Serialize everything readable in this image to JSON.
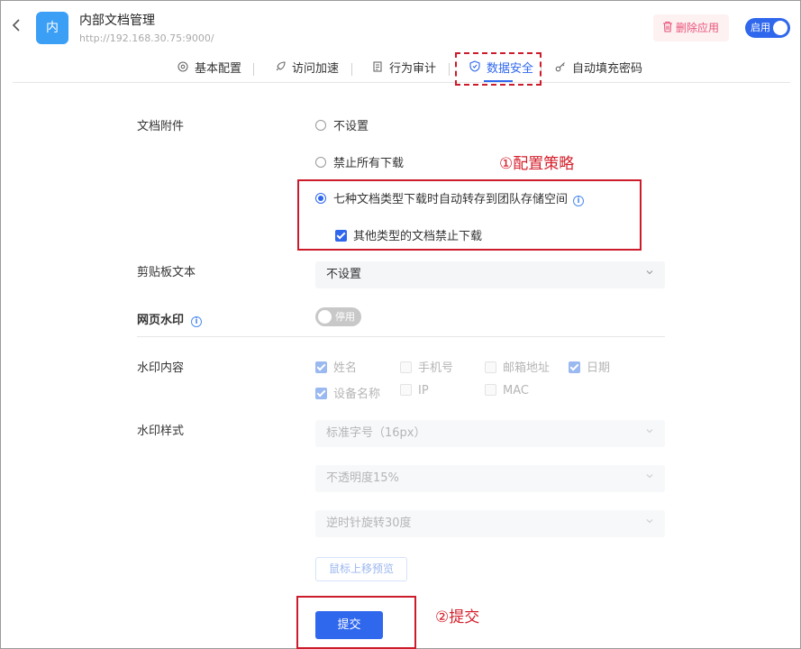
{
  "header": {
    "back_icon": "chevron-left-icon",
    "logo_text": "内",
    "logo_color": "#3a9ff5",
    "title": "内部文档管理",
    "url": "http://192.168.30.75:9000/",
    "delete_label": "删除应用",
    "delete_icon": "trash-icon",
    "enable_label": "启用",
    "enabled": true
  },
  "tabs": [
    {
      "label": "基本配置",
      "icon": "settings-icon",
      "active": false
    },
    {
      "label": "访问加速",
      "icon": "rocket-icon",
      "active": false
    },
    {
      "label": "行为审计",
      "icon": "audit-icon",
      "active": false
    },
    {
      "label": "数据安全",
      "icon": "shield-icon",
      "active": true
    },
    {
      "label": "自动填充密码",
      "icon": "key-icon",
      "active": false
    }
  ],
  "form": {
    "doc_attachment": {
      "label": "文档附件",
      "options": [
        {
          "label": "不设置",
          "checked": false
        },
        {
          "label": "禁止所有下载",
          "checked": false
        },
        {
          "label": "七种文档类型下载时自动转存到团队存储空间",
          "checked": true,
          "has_info": true
        }
      ],
      "sub_checkbox": {
        "label": "其他类型的文档禁止下载",
        "checked": true
      }
    },
    "clipboard": {
      "label": "剪贴板文本",
      "value": "不设置"
    },
    "watermark": {
      "label": "网页水印",
      "toggle_label": "停用",
      "enabled": false
    },
    "watermark_content": {
      "label": "水印内容",
      "items": [
        {
          "label": "姓名",
          "checked": true
        },
        {
          "label": "手机号",
          "checked": false
        },
        {
          "label": "邮箱地址",
          "checked": false
        },
        {
          "label": "日期",
          "checked": true
        },
        {
          "label": "设备名称",
          "checked": true
        },
        {
          "label": "IP",
          "checked": false
        },
        {
          "label": "MAC",
          "checked": false
        }
      ]
    },
    "watermark_style": {
      "label": "水印样式",
      "font_size": "标准字号（16px）",
      "opacity": "不透明度15%",
      "rotation": "逆时针旋转30度"
    },
    "preview_label": "鼠标上移预览",
    "submit_label": "提交"
  },
  "annotations": {
    "step1": "①配置策略",
    "step2": "②提交",
    "color": "#cc1b2b"
  },
  "colors": {
    "primary": "#2f67ed",
    "danger": "#e9537a"
  }
}
